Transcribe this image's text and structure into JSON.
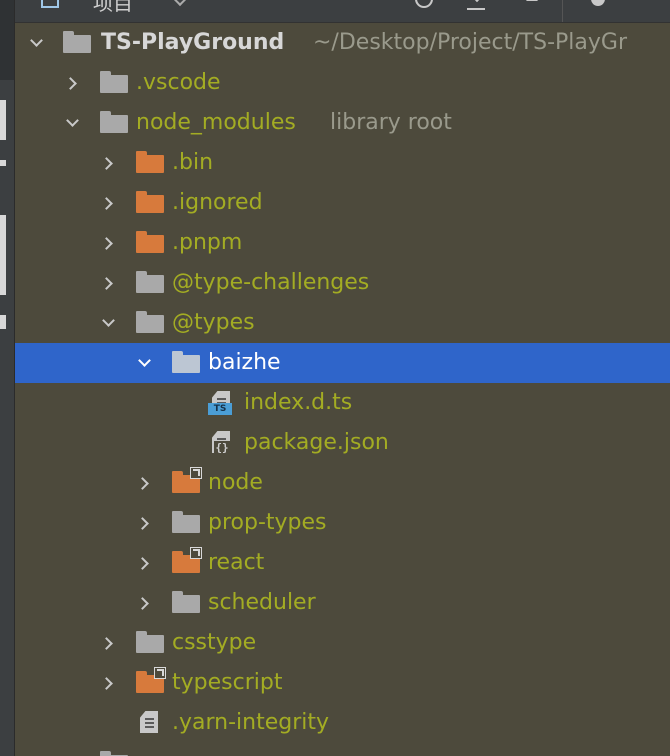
{
  "toolbar": {
    "view_label": "项目",
    "buttons": [
      "locate-icon",
      "collapse-all-icon",
      "expand-icon",
      "gear-icon"
    ]
  },
  "tree": {
    "root": {
      "label": "TS-PlayGround",
      "path": "~/Desktop/Project/TS-PlayGr"
    },
    "vscode": ".vscode",
    "node_modules": {
      "label": "node_modules",
      "hint": "library root"
    },
    "bin": ".bin",
    "ignored": ".ignored",
    "pnpm": ".pnpm",
    "type_challenges": "@type-challenges",
    "types": "@types",
    "baizhe": "baizhe",
    "index_dts": "index.d.ts",
    "ts_badge": "TS",
    "package_json": "package.json",
    "json_badge": "{}",
    "node": "node",
    "prop_types": "prop-types",
    "react": "react",
    "scheduler": "scheduler",
    "csstype": "csstype",
    "typescript": "typescript",
    "yarn_integrity": ".yarn-integrity"
  },
  "colors": {
    "tree_background": "#4d4a3c",
    "selection": "#2f65ca",
    "library_text": "#a3ac23",
    "excluded_folder": "#d77a3c",
    "folder": "#a9a9a9"
  }
}
